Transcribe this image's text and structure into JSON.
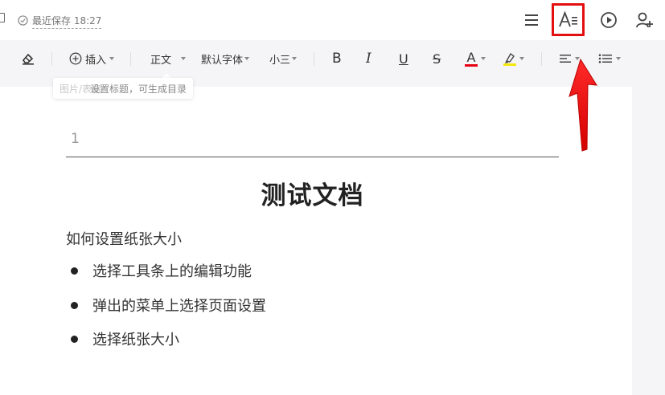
{
  "topbar": {
    "save_status": "最近保存 18:27"
  },
  "toolbar": {
    "insert_label": "插入",
    "paragraph_style": "正文",
    "font_family": "默认字体",
    "font_size": "小三",
    "bold": "B",
    "italic": "I",
    "underline": "U",
    "strike": "S",
    "font_color_letter": "A"
  },
  "colors": {
    "font_color": "#e60012",
    "highlight_color": "#f5e60c",
    "annotation_red": "#e30f0f"
  },
  "tooltip": {
    "faded_text": "图片/表格",
    "text": "设置标题，可生成目录"
  },
  "document": {
    "header_text": "1",
    "title": "测试文档",
    "paragraph": "如何设置纸张大小",
    "bullets": [
      "选择工具条上的编辑功能",
      "弹出的菜单上选择页面设置",
      "选择纸张大小"
    ]
  },
  "icons": {
    "menu": "menu-icon",
    "outline": "outline-icon",
    "play": "play-icon",
    "add_user": "add-user-icon"
  }
}
